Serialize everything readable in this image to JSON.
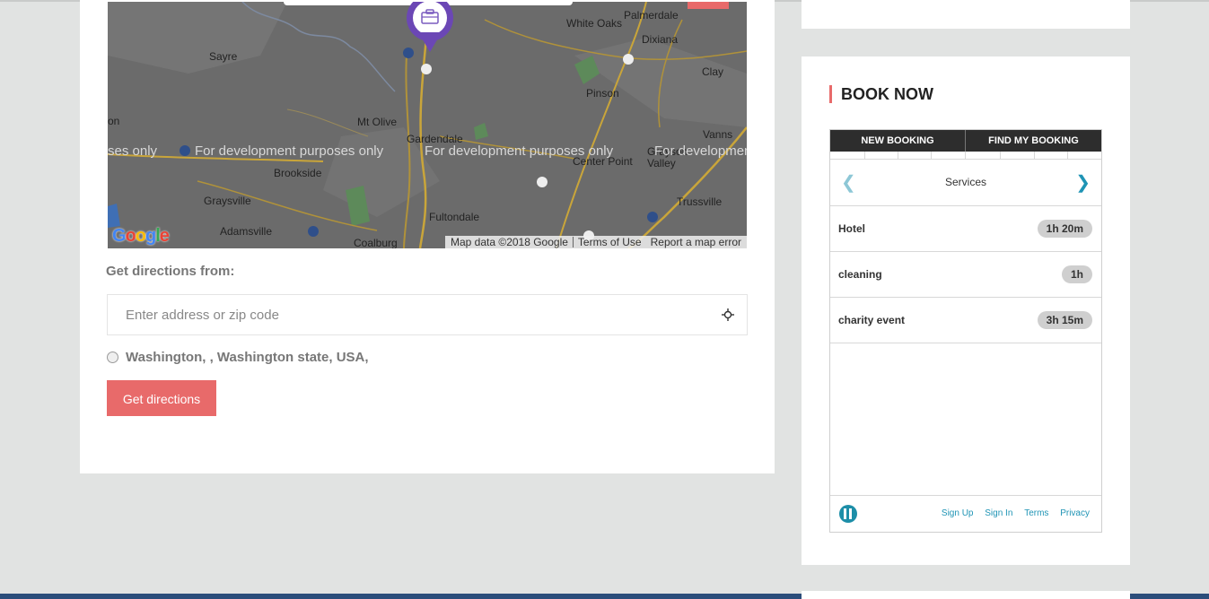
{
  "map": {
    "places": [
      {
        "name": "Palmerdale",
        "id": "palmerdale"
      },
      {
        "name": "White Oaks",
        "id": "white-oaks"
      },
      {
        "name": "Dixiana",
        "id": "dixiana"
      },
      {
        "name": "Sayre",
        "id": "sayre"
      },
      {
        "name": "Clay",
        "id": "clay"
      },
      {
        "name": "Pinson",
        "id": "pinson"
      },
      {
        "name": "Mt Olive",
        "id": "mt-olive"
      },
      {
        "name": "Vanns",
        "id": "vanns"
      },
      {
        "name": "Gardendale",
        "id": "gardendale"
      },
      {
        "name": "Center Point",
        "id": "center-point"
      },
      {
        "name": "Grayson Valley",
        "id": "grayson-valley"
      },
      {
        "name": "Brookside",
        "id": "brookside"
      },
      {
        "name": "Graysville",
        "id": "graysville"
      },
      {
        "name": "Trussville",
        "id": "trussville"
      },
      {
        "name": "Fultondale",
        "id": "fultondale"
      },
      {
        "name": "Adamsville",
        "id": "adamsville"
      },
      {
        "name": "Coalburg",
        "id": "coalburg"
      },
      {
        "name": "on",
        "id": "on"
      }
    ],
    "dev_watermark": "For development purposes only",
    "dev_partial_left": "ses only",
    "dev_partial_right": "For developmen",
    "attribution_data": "Map data ©2018 Google",
    "attribution_terms": "Terms of Use",
    "attribution_report": "Report a map error",
    "logo_letters": [
      "G",
      "o",
      "o",
      "g",
      "l",
      "e"
    ],
    "logo_colors": [
      "#4285f4",
      "#ea4335",
      "#fbbc05",
      "#4285f4",
      "#34a853",
      "#ea4335"
    ],
    "marker_icon": "briefcase-icon",
    "marker_color": "#6b47b5"
  },
  "directions": {
    "label": "Get directions from:",
    "placeholder": "Enter address or zip code",
    "locate_icon": "crosshair-icon",
    "option_label": "Washington, , Washington state, USA,",
    "button_label": "Get directions",
    "accent_color": "#e86a6a"
  },
  "booking": {
    "title": "BOOK NOW",
    "tabs": [
      "NEW BOOKING",
      "FIND MY BOOKING"
    ],
    "services_heading": "Services",
    "services": [
      {
        "name": "Hotel",
        "duration": "1h 20m"
      },
      {
        "name": "cleaning",
        "duration": "1h"
      },
      {
        "name": "charity event",
        "duration": "3h 15m"
      }
    ],
    "footer_links": [
      "Sign Up",
      "Sign In",
      "Terms",
      "Privacy"
    ],
    "link_color": "#1f94b5"
  }
}
